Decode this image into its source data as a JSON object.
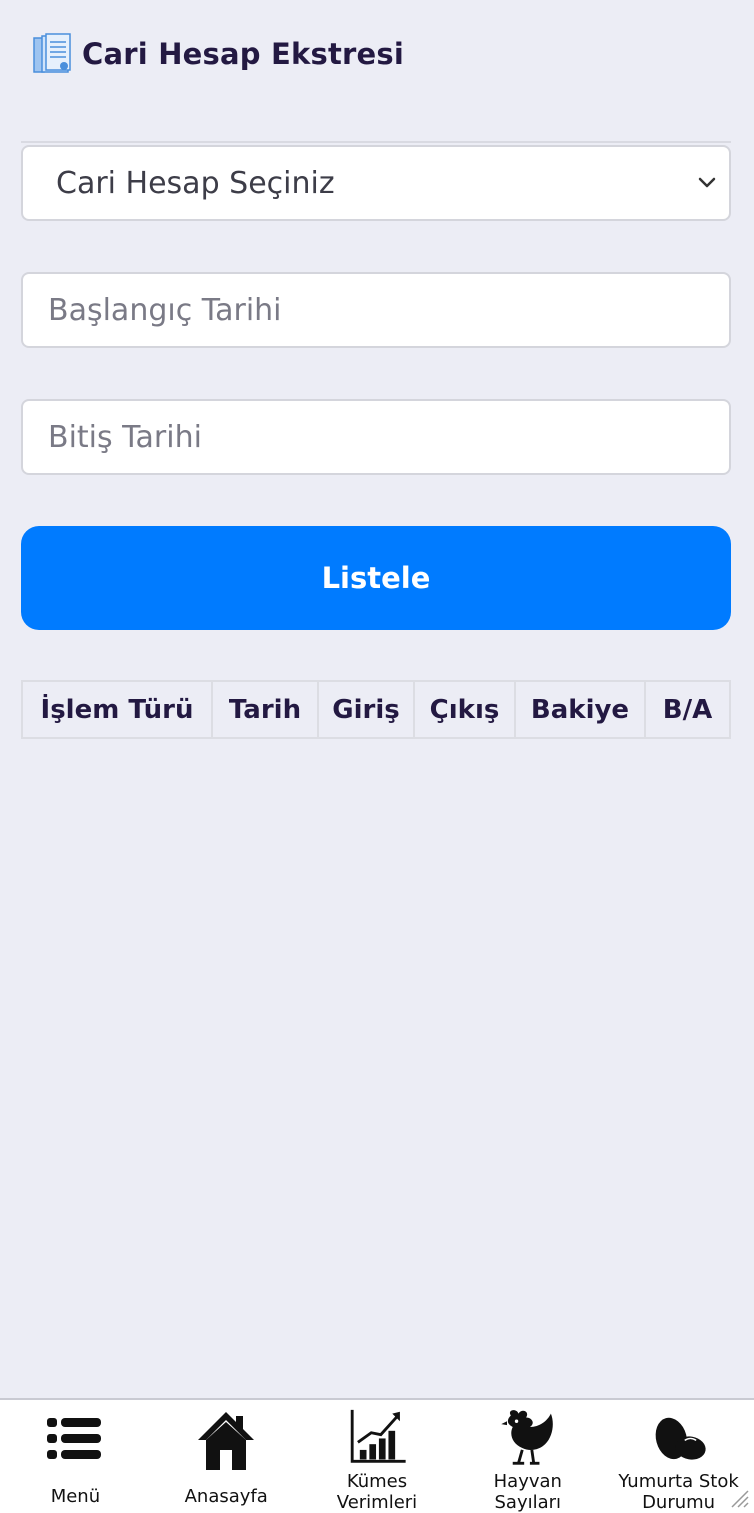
{
  "header": {
    "title": "Cari Hesap Ekstresi",
    "icon": "document-ledger-icon"
  },
  "form": {
    "account_select": {
      "value": "Cari Hesap Seçiniz",
      "options": [
        "Cari Hesap Seçiniz"
      ]
    },
    "start_date": {
      "placeholder": "Başlangıç Tarihi",
      "value": ""
    },
    "end_date": {
      "placeholder": "Bitiş Tarihi",
      "value": ""
    },
    "submit_label": "Listele"
  },
  "table": {
    "columns": [
      "İşlem Türü",
      "Tarih",
      "Giriş",
      "Çıkış",
      "Bakiye",
      "B/A"
    ],
    "rows": []
  },
  "bottom_nav": {
    "items": [
      {
        "label": "Menü",
        "icon": "menu-icon"
      },
      {
        "label": "Anasayfa",
        "icon": "home-icon"
      },
      {
        "label_line1": "Kümes",
        "label_line2": "Verimleri",
        "icon": "growth-chart-icon"
      },
      {
        "label_line1": "Hayvan",
        "label_line2": "Sayıları",
        "icon": "chicken-icon"
      },
      {
        "label_line1": "Yumurta Stok",
        "label_line2": "Durumu",
        "icon": "eggs-icon"
      }
    ]
  },
  "colors": {
    "background": "#ecedf5",
    "primary": "#007bff",
    "text": "#231942"
  }
}
